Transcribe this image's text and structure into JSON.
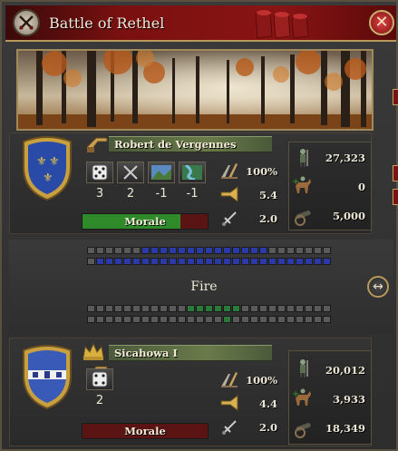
{
  "header": {
    "title": "Battle of Rethel"
  },
  "attacker": {
    "commander": "Robert de Vergennes",
    "pips": [
      "3",
      "2",
      "-1",
      "-1"
    ],
    "pip_icons": [
      "dice-icon",
      "crossed-swords-icon",
      "terrain-icon",
      "river-crossing-icon"
    ],
    "discipline": "100%",
    "morale_value": "5.4",
    "tactics": "2.0",
    "morale_label": "Morale",
    "morale_fraction": 0.78,
    "infantry": "27,323",
    "cavalry": "0",
    "artillery": "5,000"
  },
  "defender": {
    "commander": "Sicahowa I",
    "pips": [
      "2"
    ],
    "pip_icons": [
      "dice-icon"
    ],
    "discipline": "100%",
    "morale_value": "4.4",
    "tactics": "2.0",
    "morale_label": "Morale",
    "morale_fraction": 0.0,
    "infantry": "20,012",
    "cavalry": "3,933",
    "artillery": "18,349"
  },
  "combat": {
    "phase": "Fire"
  },
  "colors": {
    "morale_green": "#2f8a2a",
    "morale_red": "#5a1414",
    "unit_blue": "#2a3aa8",
    "unit_green": "#2c7a3a"
  }
}
